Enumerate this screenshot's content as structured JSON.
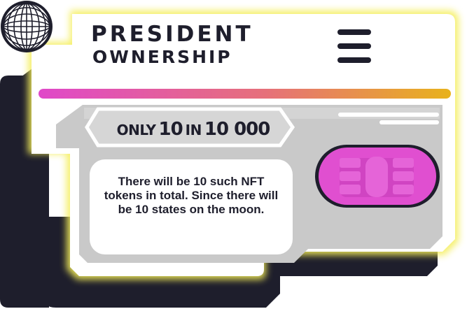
{
  "header": {
    "title_line1": "PRESIDENT",
    "title_line2": "OWNERSHIP",
    "menu_icon": "hamburger-menu-icon",
    "globe_icon": "globe-icon"
  },
  "ribbon": {
    "word_only": "ONLY",
    "count": "10",
    "word_in": "IN",
    "total": "10 000"
  },
  "description": "There will be 10 such NFT tokens in total. Since there will be 10 states on the moon.",
  "chip_icon": "sim-chip-icon",
  "colors": {
    "dark": "#1e1e2c",
    "card": "#ffffff",
    "panel": "#c9c9c9",
    "glow": "#f4ee5a",
    "gradient_start": "#e048c9",
    "gradient_end": "#e8b21c",
    "chip": "#e04fd0"
  }
}
